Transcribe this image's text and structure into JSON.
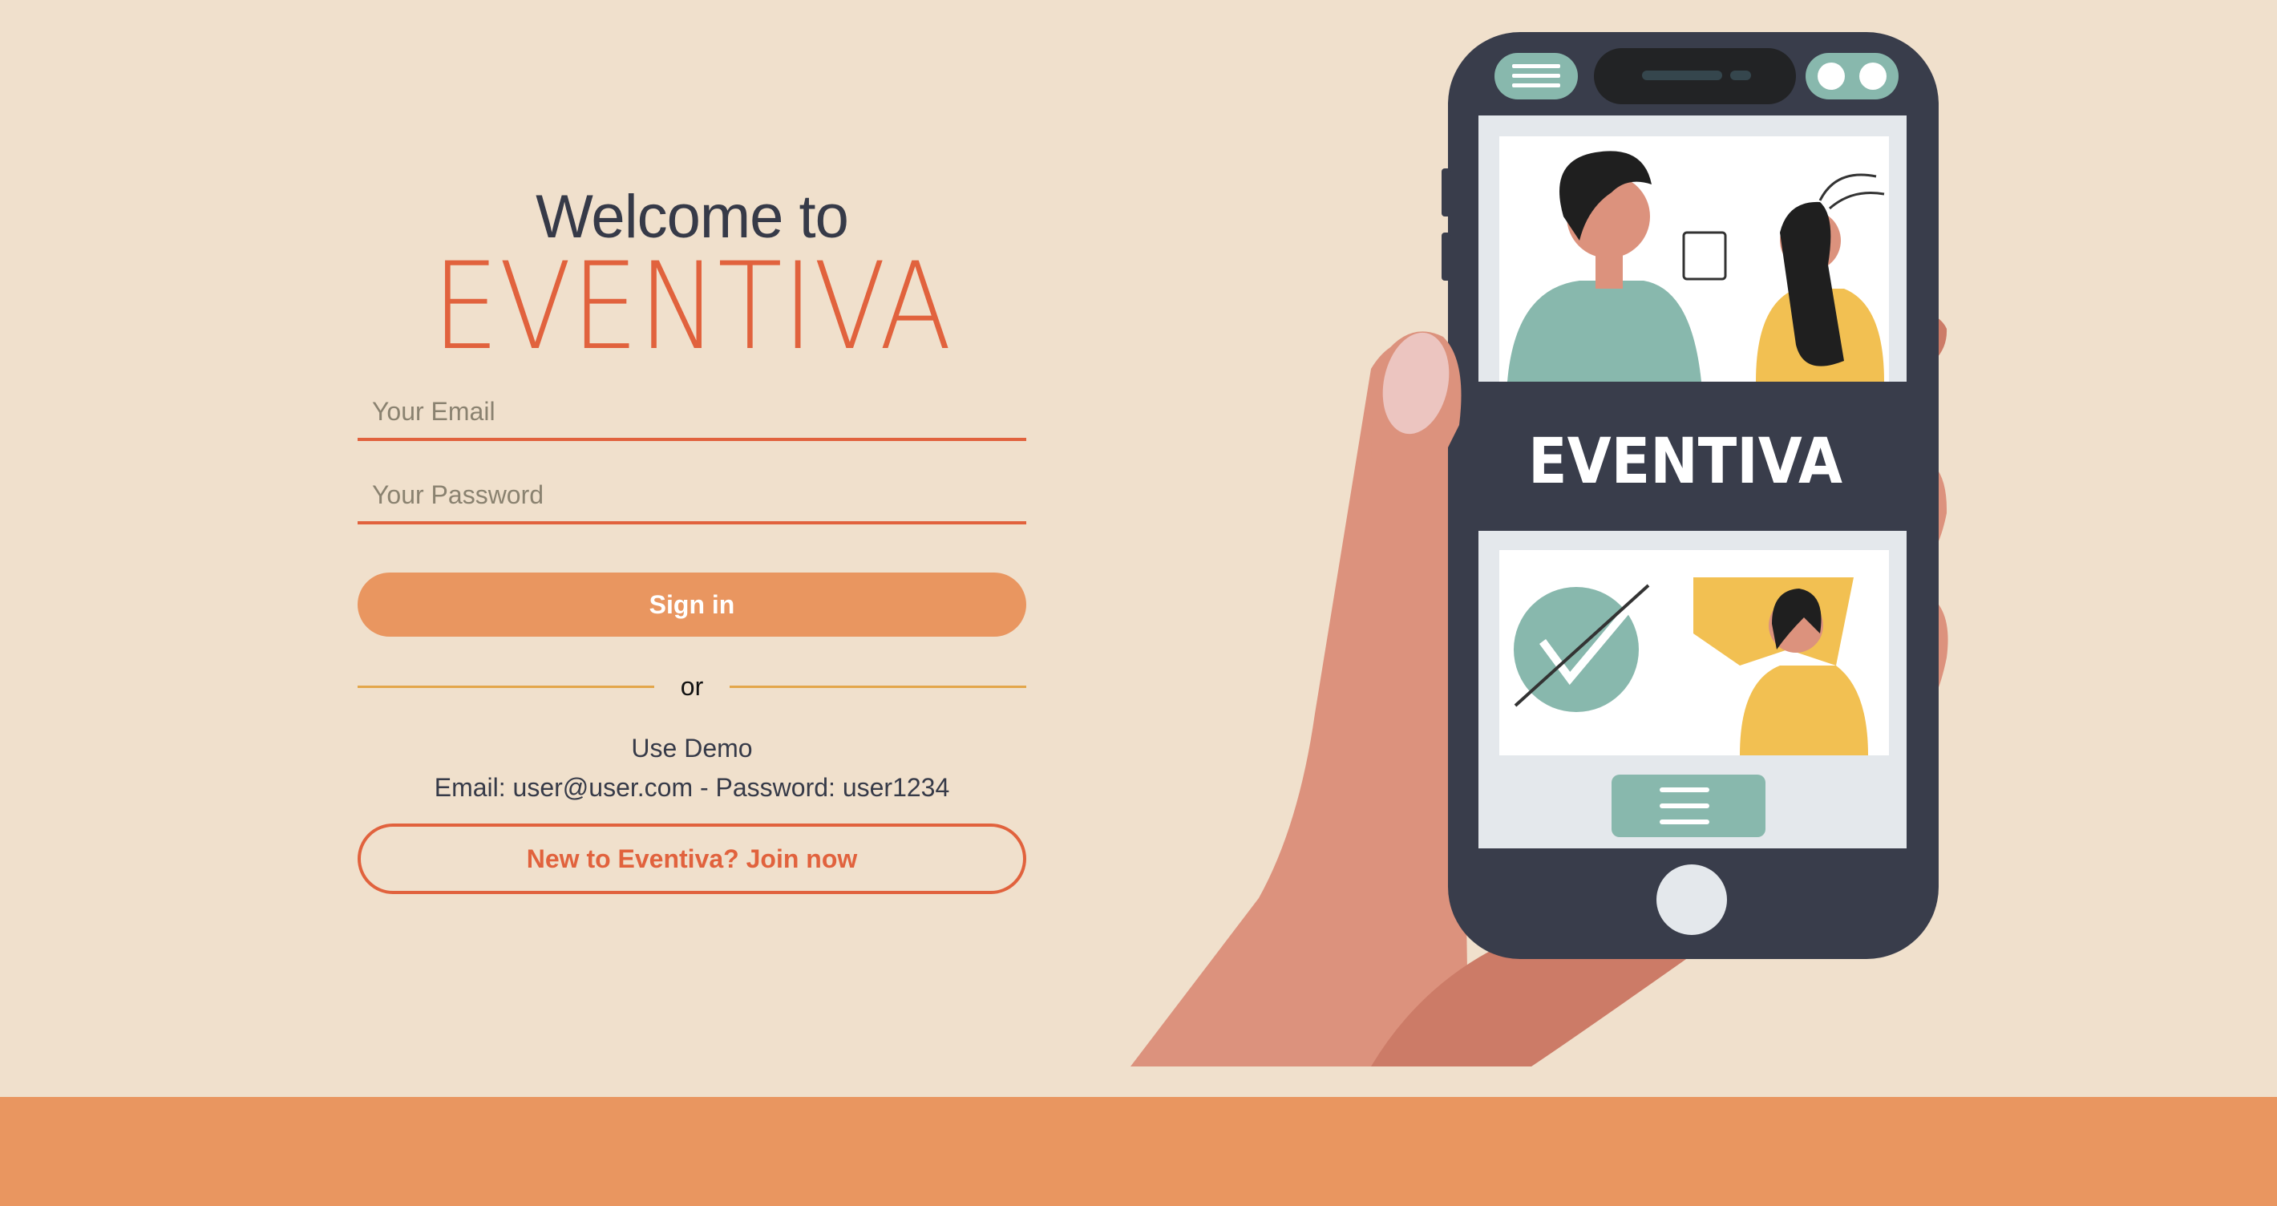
{
  "login": {
    "welcome": "Welcome to",
    "brand": "EVENTIVA",
    "email_placeholder": "Your Email",
    "password_placeholder": "Your Password",
    "signin_label": "Sign in",
    "divider_text": "or",
    "demo_title": "Use Demo",
    "demo_credentials": "Email: user@user.com - Password: user1234",
    "join_label": "New to Eventiva? Join now"
  },
  "phone": {
    "brand": "EVENTIVA"
  },
  "colors": {
    "background": "#f0e0cc",
    "accent": "#e1623d",
    "button": "#e99660",
    "divider": "#e3a64a",
    "text": "#363a48",
    "phone": "#393d4b",
    "teal": "#88b8ad",
    "yellow": "#f2c052",
    "skin": "#dc927d"
  }
}
